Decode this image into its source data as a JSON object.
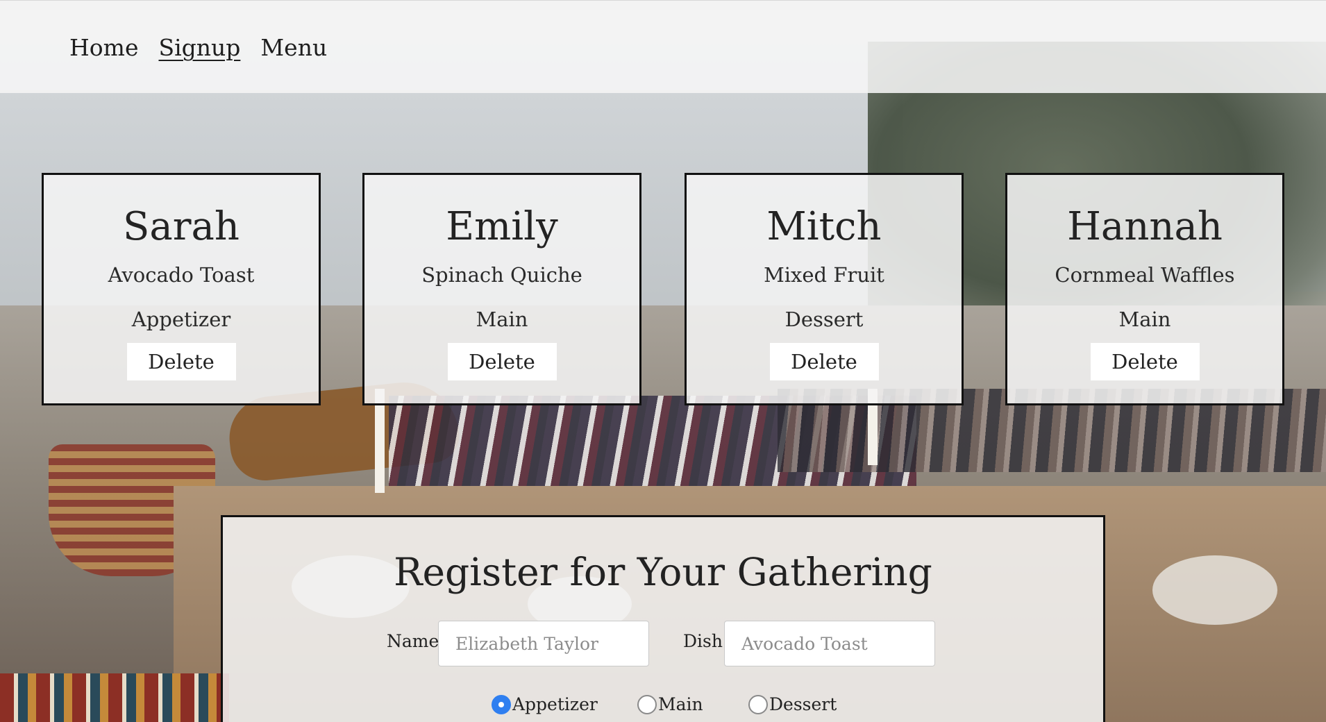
{
  "nav": {
    "items": [
      {
        "label": "Home",
        "active": false
      },
      {
        "label": "Signup",
        "active": true
      },
      {
        "label": "Menu",
        "active": false
      }
    ]
  },
  "cards": [
    {
      "name": "Sarah",
      "dish": "Avocado Toast",
      "course": "Appetizer",
      "delete_label": "Delete"
    },
    {
      "name": "Emily",
      "dish": "Spinach Quiche",
      "course": "Main",
      "delete_label": "Delete"
    },
    {
      "name": "Mitch",
      "dish": "Mixed Fruit",
      "course": "Dessert",
      "delete_label": "Delete"
    },
    {
      "name": "Hannah",
      "dish": "Cornmeal Waffles",
      "course": "Main",
      "delete_label": "Delete"
    }
  ],
  "form": {
    "title": "Register for Your Gathering",
    "name_label": "Name",
    "name_placeholder": "Elizabeth Taylor",
    "name_value": "",
    "dish_label": "Dish",
    "dish_placeholder": "Avocado Toast",
    "dish_value": "",
    "course_options": [
      "Appetizer",
      "Main",
      "Dessert"
    ],
    "course_selected": "Appetizer"
  },
  "colors": {
    "radio_accent": "#2f7ff0",
    "card_border": "#111111"
  }
}
